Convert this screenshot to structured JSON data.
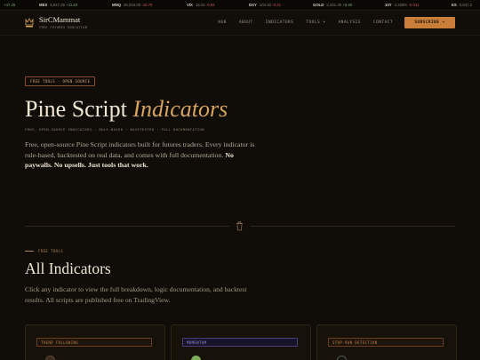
{
  "ticker": [
    {
      "sym": "",
      "val": "",
      "chg": "+47.25",
      "dir": "up"
    },
    {
      "sym": "MES",
      "val": "5,647.25",
      "chg": "+11.50",
      "dir": "up"
    },
    {
      "sym": "MNQ",
      "val": "20,034.00",
      "chg": "-16.75",
      "dir": "down"
    },
    {
      "sym": "VIX",
      "val": "16.24",
      "chg": "-0.84",
      "dir": "down"
    },
    {
      "sym": "DXY",
      "val": "104.32",
      "chg": "-0.21",
      "dir": "down"
    },
    {
      "sym": "GOLD",
      "val": "2,341.40",
      "chg": "+8.60",
      "dir": "up"
    },
    {
      "sym": "10Y",
      "val": "4.328%",
      "chg": "-0.011",
      "dir": "down"
    },
    {
      "sym": "ES",
      "val": "5,647.2",
      "chg": "",
      "dir": "up"
    }
  ],
  "brand": {
    "name": "SirCMammat",
    "tagline": "FREE FUTURES EDUCATION"
  },
  "nav": {
    "links": [
      "HUB",
      "ABOUT",
      "INDICATORS",
      "TOOLS ▾",
      "ANALYSIS",
      "CONTACT"
    ],
    "subscribe": "SUBSCRIBE →"
  },
  "hero": {
    "badge": "FREE TOOLS · OPEN SOURCE",
    "title_plain": "Pine Script ",
    "title_accent": "Indicators",
    "subtitle": "FREE, OPEN-SOURCE INDICATORS · RULE-BASED · BACKTESTED · FULL DOCUMENTATION",
    "description": "Free, open-source Pine Script indicators built for futures traders. Every indicator is rule-based, backtested on real data, and comes with full documentation.",
    "description_bold": "No paywalls. No upsells. Just tools that work."
  },
  "section": {
    "eyebrow": "FREE TOOLS",
    "title": "All Indicators",
    "description": "Click any indicator to view the full breakdown, logic documentation, and backtest results. All scripts are published free on TradingView."
  },
  "cards": [
    {
      "label": "TREND FOLLOWING",
      "color": "#c97f3a",
      "dot": "#3a2a1a"
    },
    {
      "label": "MOMENTUM",
      "color": "#8a7ad0",
      "dot": "#7fae5a"
    },
    {
      "label": "STOP-RUN DETECTION",
      "color": "#c97f3a",
      "dot": "#2d3a3a"
    }
  ],
  "colors": {
    "accent": "#c97f3a",
    "gold": "#d6a45f",
    "background": "#100d08"
  }
}
